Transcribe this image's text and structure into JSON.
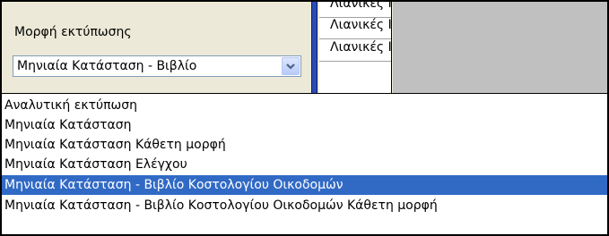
{
  "print_format": {
    "label": "Μορφή εκτύπωσης",
    "selected_value": "Μηνιαία Κατάσταση - Βιβλίο"
  },
  "grid": {
    "cells": [
      "Λιανικές Ι",
      "Λιανικές Ι",
      "Λιανικές Ι"
    ]
  },
  "dropdown": {
    "options": [
      "Αναλυτική εκτύπωση",
      "Μηνιαία Κατάσταση",
      "Μηνιαία Κατάσταση Κάθετη μορφή",
      "Μηνιαία Κατάσταση Ελέγχου",
      "Μηνιαία Κατάσταση - Βιβλίο Κοστολογίου Οικοδομών",
      "Μηνιαία Κατάσταση - Βιβλίο Κοστολογίου Οικοδομών Κάθετη μορφή"
    ],
    "highlighted_index": 4
  },
  "icons": {
    "combo_button": "chevron-down-icon"
  },
  "colors": {
    "highlight": "#316ac5",
    "grid_separator": "#2d4bb0"
  }
}
